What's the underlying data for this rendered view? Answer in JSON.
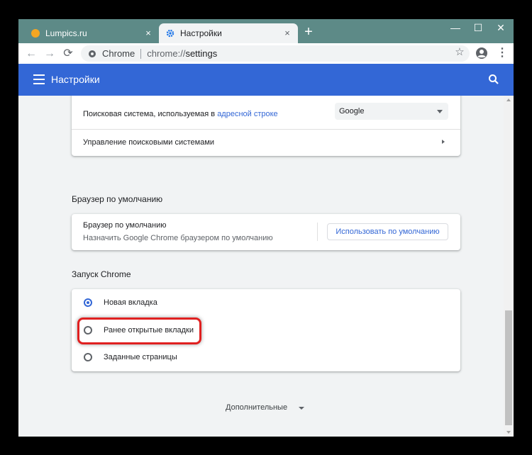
{
  "tabs": [
    {
      "label": "Lumpics.ru",
      "close": "×",
      "icon": "site-favicon-orange"
    },
    {
      "label": "Настройки",
      "close": "×",
      "icon": "gear-icon"
    }
  ],
  "new_tab": "+",
  "window_controls": {
    "minimize": "—",
    "maximize": "☐",
    "close": "✕"
  },
  "toolbar": {
    "back": "←",
    "forward": "→",
    "reload": "⟳",
    "omnibox": {
      "chip": "Chrome",
      "scheme": "chrome://",
      "path": "settings"
    },
    "star": "☆",
    "menu": "⋮"
  },
  "header": {
    "title": "Настройки"
  },
  "search_engine": {
    "label_prefix": "Поисковая система, используемая в ",
    "label_link": "адресной строке",
    "selected": "Google",
    "manage_label": "Управление поисковыми системами"
  },
  "default_browser": {
    "section_title": "Браузер по умолчанию",
    "title": "Браузер по умолчанию",
    "subtitle": "Назначить Google Chrome браузером по умолчанию",
    "button": "Использовать по умолчанию"
  },
  "startup": {
    "section_title": "Запуск Chrome",
    "options": [
      {
        "label": "Новая вкладка",
        "checked": true
      },
      {
        "label": "Ранее открытые вкладки",
        "checked": false
      },
      {
        "label": "Заданные страницы",
        "checked": false
      }
    ]
  },
  "advanced": {
    "label": "Дополнительные"
  },
  "colors": {
    "header": "#3367d6",
    "titlebar": "#5d8a87",
    "highlight": "#e02020"
  }
}
